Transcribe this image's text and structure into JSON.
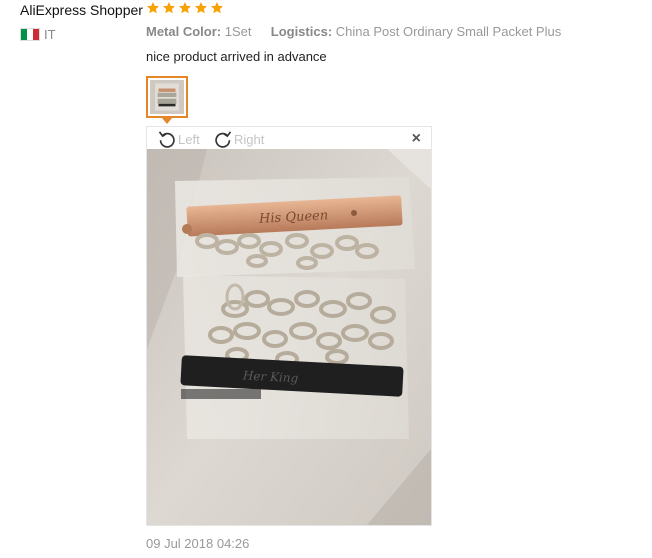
{
  "review": {
    "buyer_name": "AliExpress Shopper",
    "country_code": "IT",
    "flag_colors": [
      "#009246",
      "#ffffff",
      "#ce2b37"
    ],
    "rating": 5,
    "star_color": "#f7a200",
    "attributes": [
      {
        "label": "Metal Color:",
        "value": "1Set"
      },
      {
        "label": "Logistics:",
        "value": "China Post Ordinary Small Packet Plus"
      }
    ],
    "text": "nice product arrived in advance",
    "date": "09 Jul 2018 04:26"
  },
  "viewer": {
    "rotate_left_label": "Left",
    "rotate_right_label": "Right",
    "close_icon": "×",
    "accent_color": "#e6862b",
    "photo": {
      "top_plate_text": "His Queen",
      "bottom_plate_text": "Her King"
    }
  }
}
